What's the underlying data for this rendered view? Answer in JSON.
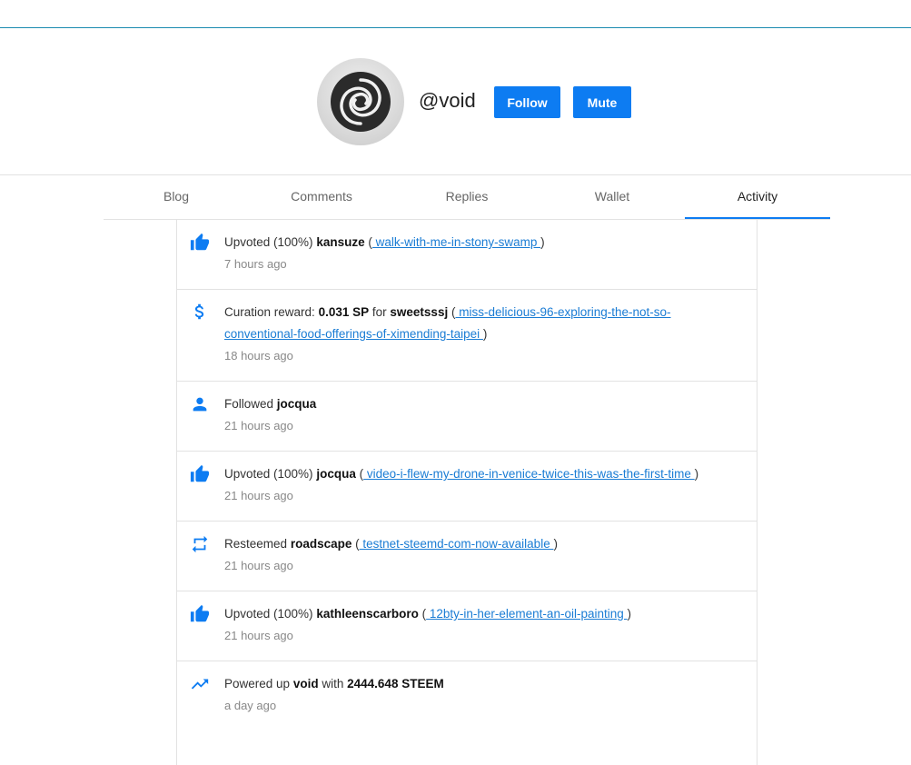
{
  "profile": {
    "handle": "@void",
    "follow_label": "Follow",
    "mute_label": "Mute"
  },
  "tabs": [
    {
      "label": "Blog"
    },
    {
      "label": "Comments"
    },
    {
      "label": "Replies"
    },
    {
      "label": "Wallet"
    },
    {
      "label": "Activity"
    }
  ],
  "activity": [
    {
      "icon": "thumbs-up-icon",
      "action": "Upvoted (100%)",
      "user": "kansuze",
      "link": " walk-with-me-in-stony-swamp ",
      "time": "7 hours ago"
    },
    {
      "icon": "dollar-icon",
      "action": "Curation reward:",
      "amount": "0.031 SP",
      "for": "for",
      "user": "sweetsssj",
      "link_line1": " miss-delicious-96-exploring-the-not-so-",
      "link_line2": "conventional-food-offerings-of-ximending-taipei ",
      "time": "18 hours ago"
    },
    {
      "icon": "person-icon",
      "action": "Followed",
      "user": "jocqua",
      "time": "21 hours ago"
    },
    {
      "icon": "thumbs-up-icon",
      "action": "Upvoted (100%)",
      "user": "jocqua",
      "link": " video-i-flew-my-drone-in-venice-twice-this-was-the-first-time ",
      "time": "21 hours ago"
    },
    {
      "icon": "resteem-icon",
      "action": "Resteemed",
      "user": "roadscape",
      "link": " testnet-steemd-com-now-available ",
      "time": "21 hours ago"
    },
    {
      "icon": "thumbs-up-icon",
      "action": "Upvoted (100%)",
      "user": "kathleenscarboro",
      "link": " 12bty-in-her-element-an-oil-painting ",
      "time": "21 hours ago"
    },
    {
      "icon": "trending-up-icon",
      "action": "Powered up",
      "user": "void",
      "with": "with",
      "amount": "2444.648 STEEM",
      "time": "a day ago"
    }
  ],
  "colors": {
    "accent": "#0d7cf2",
    "link": "#1a7cd4",
    "top_border": "#1a8bb0"
  }
}
